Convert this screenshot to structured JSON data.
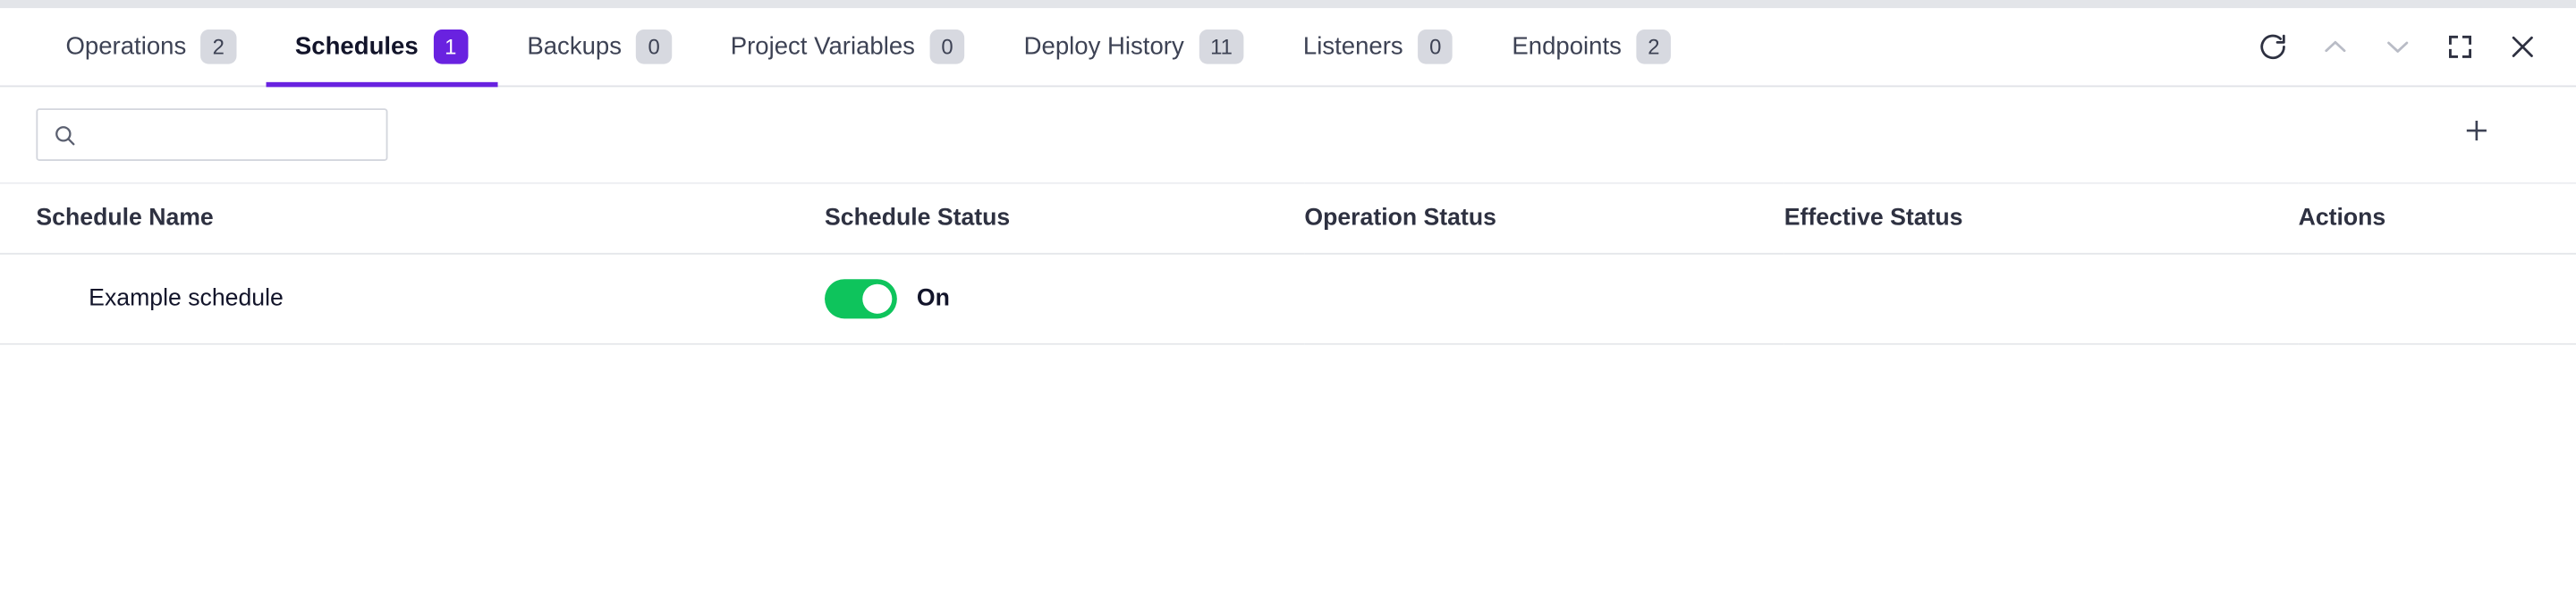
{
  "tabs": [
    {
      "label": "Operations",
      "count": "2",
      "active": false,
      "name": "tab-operations"
    },
    {
      "label": "Schedules",
      "count": "1",
      "active": true,
      "name": "tab-schedules"
    },
    {
      "label": "Backups",
      "count": "0",
      "active": false,
      "name": "tab-backups"
    },
    {
      "label": "Project Variables",
      "count": "0",
      "active": false,
      "name": "tab-project-variables"
    },
    {
      "label": "Deploy History",
      "count": "11",
      "active": false,
      "name": "tab-deploy-history"
    },
    {
      "label": "Listeners",
      "count": "0",
      "active": false,
      "name": "tab-listeners"
    },
    {
      "label": "Endpoints",
      "count": "2",
      "active": false,
      "name": "tab-endpoints"
    }
  ],
  "window_tools": [
    {
      "icon": "refresh-icon",
      "label": "Refresh",
      "disabled": false
    },
    {
      "icon": "chevron-up-icon",
      "label": "Previous",
      "disabled": true
    },
    {
      "icon": "chevron-down-icon",
      "label": "Next",
      "disabled": true
    },
    {
      "icon": "fullscreen-icon",
      "label": "Fullscreen",
      "disabled": false
    },
    {
      "icon": "close-icon",
      "label": "Close",
      "disabled": false
    }
  ],
  "search": {
    "value": "",
    "placeholder": "",
    "icon": "search-icon"
  },
  "actions": {
    "add_label": "+",
    "add_icon": "plus-icon"
  },
  "table": {
    "columns": [
      "Schedule Name",
      "Schedule Status",
      "Operation Status",
      "Effective Status",
      "Actions"
    ],
    "rows": [
      {
        "name": "Example schedule",
        "schedule_status": {
          "toggle": "on",
          "label": "On"
        },
        "operation_status": "",
        "effective_status": "",
        "actions": ""
      }
    ]
  },
  "colors": {
    "accent": "#6922e0",
    "badge_bg": "#d7d9e0",
    "toggle_on": "#0ec45c",
    "text": "#12142a",
    "border": "#e4e6ea"
  }
}
